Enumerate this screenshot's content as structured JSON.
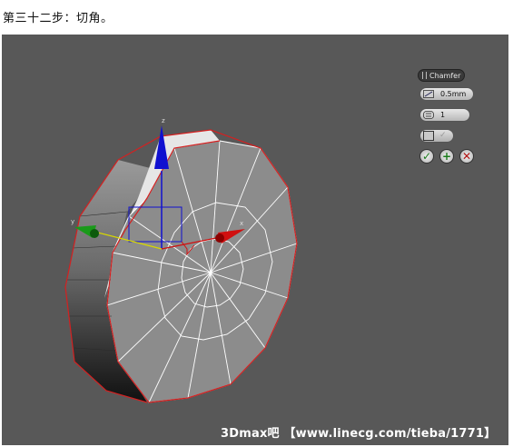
{
  "caption": "第三十二步：切角。",
  "caddy": {
    "title": "Chamfer",
    "amount": "0.5mm",
    "segments": "1",
    "buttons": {
      "ok_icon": "checkmark-icon",
      "apply_icon": "plus-icon",
      "cancel_icon": "x-icon"
    }
  },
  "watermark": "3Dmax吧 【www.linecg.com/tieba/1771】",
  "colors": {
    "viewport_bg": "#585858",
    "edge_selection": "#d42020",
    "gizmo_y": "#1a9a1a",
    "gizmo_z": "#1010d0",
    "gizmo_x": "#d01010"
  }
}
